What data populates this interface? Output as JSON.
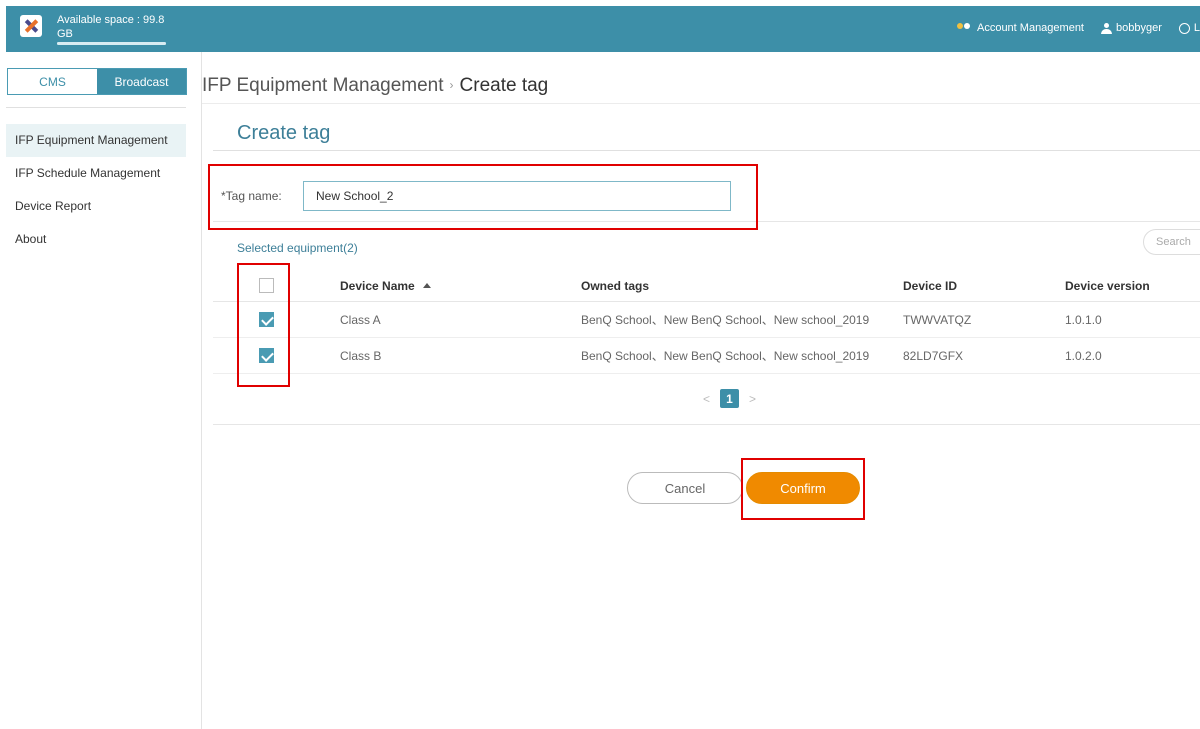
{
  "topbar": {
    "storage_line1": "Available space : 99.8",
    "storage_line2": "GB",
    "storage_used_fraction": 1.0,
    "account_management": "Account Management",
    "username": "bobbyger",
    "language_fragment": "L"
  },
  "sidebar": {
    "modes": [
      "CMS",
      "Broadcast"
    ],
    "active_mode": "Broadcast",
    "items": [
      {
        "label": "IFP Equipment Management",
        "active": true
      },
      {
        "label": "IFP Schedule Management",
        "active": false
      },
      {
        "label": "Device Report",
        "active": false
      },
      {
        "label": "About",
        "active": false
      }
    ]
  },
  "breadcrumb": {
    "parent": "IFP Equipment Management",
    "separator": "›",
    "current": "Create tag"
  },
  "form": {
    "heading": "Create tag",
    "tag_label": "*Tag name:",
    "tag_value": "New School_2",
    "selected_label": "Selected equipment(2)",
    "search_placeholder": "Search"
  },
  "table": {
    "columns": [
      "Device Name",
      "Owned tags",
      "Device ID",
      "Device version"
    ],
    "rows": [
      {
        "checked": true,
        "name": "Class A",
        "tags": "BenQ School、New BenQ School、New school_2019",
        "id": "TWWVATQZ",
        "version": "1.0.1.0"
      },
      {
        "checked": true,
        "name": "Class B",
        "tags": "BenQ School、New BenQ School、New school_2019",
        "id": "82LD7GFX",
        "version": "1.0.2.0"
      }
    ]
  },
  "pager": {
    "prev": "<",
    "page": "1",
    "next": ">"
  },
  "actions": {
    "cancel": "Cancel",
    "confirm": "Confirm"
  },
  "colors": {
    "header": "#3d8fa8",
    "accent": "#3d7f98",
    "confirm": "#f08a00",
    "highlight": "#e00000"
  }
}
